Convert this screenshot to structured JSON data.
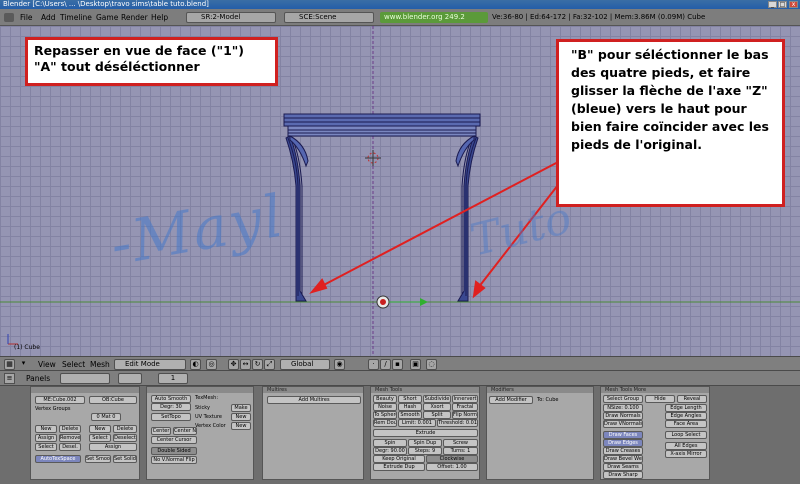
{
  "window": {
    "title": "Blender [C:\\Users\\ ... \\Desktop\\travo sims\\table tuto.blend]",
    "minimize": "_",
    "maximize": "□",
    "close": "x"
  },
  "topmenu": {
    "items": [
      "File",
      "Add",
      "Timeline",
      "Game",
      "Render",
      "Help"
    ],
    "screen": "SR:2-Model",
    "scene": "SCE:Scene",
    "url": "www.blender.org 249.2",
    "stats": "Ve:36-80 | Ed:64-172 | Fa:32-102 | Mem:3.86M (0.09M) Cube"
  },
  "notes": {
    "left": [
      "Repasser en vue de face  (\"1\")",
      "\"A\" tout déséléctionner"
    ],
    "right": "\"B\" pour séléctionner le bas des quatre pieds, et faire glisser la flèche de l'axe \"Z\" (bleue) vers le haut pour bien faire coïncider avec les pieds de l'original."
  },
  "watermark": {
    "part1": "-Mayl",
    "part2": "Tuto"
  },
  "viewport": {
    "object_label": "(1) Cube"
  },
  "header3d": {
    "menus": [
      "View",
      "Select",
      "Mesh"
    ],
    "mode": "Edit Mode",
    "orientation": "Global"
  },
  "buttons_header": {
    "panels_label": "Panels",
    "frame": "1"
  },
  "panels": {
    "link_materials": {
      "me": "ME:Cube.002",
      "ob": "OB:Cube",
      "vertex_groups": "Vertex Groups",
      "rows": [
        [
          "New",
          "Delete",
          "New",
          "Delete"
        ],
        [
          "Assign",
          "Remove",
          "Select",
          "Deselect"
        ],
        [
          "Select",
          "Desel.",
          "Assign"
        ]
      ],
      "autotex": "AutoTexSpace",
      "set_smooth": "Set Smooth",
      "set_solid": "Set Solid"
    },
    "mesh": {
      "auto_smooth": "Auto Smooth",
      "degr": "Degr: 30",
      "sticky": "Sticky",
      "uv_texture": "UV Texture",
      "vertex_color": "Vertex Color",
      "make": "Make",
      "new": "New",
      "center": "Center",
      "center_new": "Center New",
      "center_cursor": "Center Cursor",
      "double_sided": "Double Sided",
      "no_v_normal_flip": "No V.Normal Flip",
      "texmesh": "TexMesh:",
      "set_topo": "SetTopo"
    },
    "multires": {
      "title": "Multires",
      "add": "Add Multires"
    },
    "mesh_tools": {
      "title": "Mesh Tools",
      "rows": [
        [
          "Beauty",
          "Short",
          "Subdivide",
          "Innervert"
        ],
        [
          "Noise",
          "Hash",
          "Xsort",
          "Fractal"
        ],
        [
          "To Sphere",
          "Smooth",
          "Split",
          "Flip Normal"
        ],
        [
          "Rem Doubles",
          "Limit: 0.001",
          "Threshold: 0.010"
        ]
      ],
      "extrude": "Extrude",
      "spin": "Spin",
      "spin_dup": "Spin Dup",
      "screw": "Screw",
      "degr": "Degr: 90.00",
      "steps": "Steps: 9",
      "turns": "Turns: 1",
      "keep_original": "Keep Original",
      "clockwise": "Clockwise",
      "extrude_dup": "Extrude Dup",
      "offset": "Offset: 1.00",
      "join_triangles": "Join Triangles",
      "threshold": "Threshold 0.800",
      "delimit": "Delimit UVs Delimit Vcol Delimit Shar Delimit Mat"
    },
    "modifiers": {
      "title": "Modifiers",
      "add": "Add Modifier",
      "to": "To: Cube"
    },
    "mesh_tools_more": {
      "title": "Mesh Tools More",
      "select_group": "Select Group",
      "hide": "Hide",
      "reveal": "Reveal",
      "nsize": "NSize: 0.100",
      "draw_normals": "Draw Normals",
      "draw_vnormals": "Draw VNormals",
      "draw_faces": "Draw Faces",
      "draw_edges": "Draw Edges",
      "draw_creases": "Draw Creases",
      "draw_bevel_weights": "Draw Bevel Weights",
      "draw_seams": "Draw Seams",
      "draw_sharp": "Draw Sharp",
      "edge_length": "Edge Length",
      "edge_angles": "Edge Angles",
      "face_area": "Face Area",
      "loop_select": "Loop Select",
      "all_edges": "All Edges",
      "xaxis_mirror": "X-axis Mirror"
    }
  }
}
